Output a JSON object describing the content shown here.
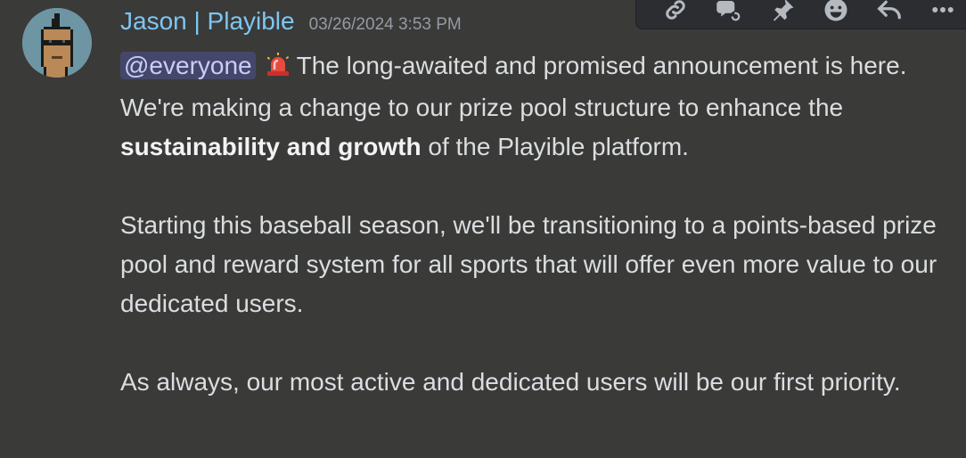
{
  "message": {
    "author": "Jason | Playible",
    "timestamp": "03/26/2024 3:53 PM",
    "avatar_icon": "pixel-punk-avatar",
    "mention": "@everyone",
    "emoji": "rotating-light",
    "paragraphs": [
      {
        "text_before": "The long-awaited and promised announcement is here. We're making a change to our prize pool structure to enhance the ",
        "bold": "sustainability and growth",
        "text_after": " of the Playible platform."
      },
      {
        "text": "Starting this baseball season, we'll be transitioning to a points-based prize pool and reward system for all sports that will offer even more value to our dedicated users."
      },
      {
        "text": "As always, our most active and dedicated users will be our first priority."
      }
    ]
  },
  "toolbar": {
    "icons": [
      "link-icon",
      "reply-thread-icon",
      "pin-icon",
      "add-reaction-icon",
      "reply-icon",
      "more-icon"
    ]
  },
  "colors": {
    "background": "#3a3a38",
    "username": "#7ec6f2",
    "timestamp": "#949ba4",
    "mention_bg": "#45476a",
    "mention_text": "#c9cdfb"
  }
}
